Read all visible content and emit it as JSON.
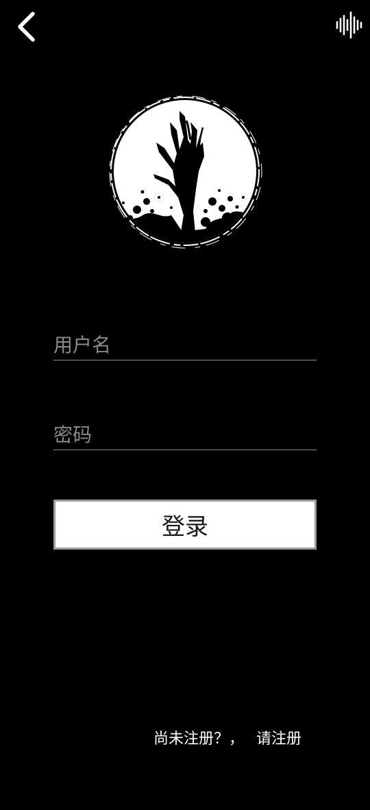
{
  "header": {
    "back_icon": "chevron-left-icon",
    "audio_icon": "sound-wave-icon"
  },
  "logo": {
    "icon": "zombie-hand-moon-logo",
    "colors": {
      "moon": "#ffffff",
      "hand": "#000000"
    }
  },
  "form": {
    "username_placeholder": "用户名",
    "username_value": "",
    "password_placeholder": "密码",
    "password_value": "",
    "login_label": "登录"
  },
  "footer": {
    "prompt": "尚未注册？，",
    "register_link": "请注册"
  },
  "colors": {
    "background": "#000000",
    "text": "#ffffff",
    "placeholder": "#8a8a8a",
    "underline": "#8e8e8e",
    "button_bg": "#ffffff",
    "button_border": "#9b9b9b"
  }
}
